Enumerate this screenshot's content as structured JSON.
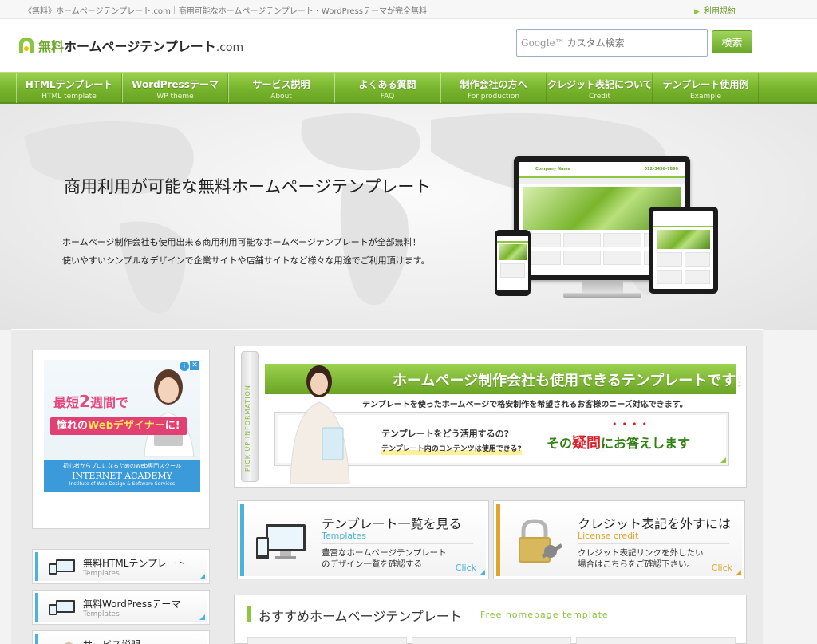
{
  "topbar": {
    "tagline": "《無料》ホームページテンプレート.com｜商用可能なホームページテンプレート・WordPressテーマが完全無料",
    "terms_link": "利用規約"
  },
  "header": {
    "logo_accent": "無料",
    "logo_main": "ホームページテンプレート",
    "logo_suffix": ".com",
    "search_brand": "Google™",
    "search_placeholder": "カスタム検索",
    "search_button": "検索"
  },
  "nav": [
    {
      "jp": "HTMLテンプレート",
      "en": "HTML template"
    },
    {
      "jp": "WordPressテーマ",
      "en": "WP theme"
    },
    {
      "jp": "サービス説明",
      "en": "About"
    },
    {
      "jp": "よくある質問",
      "en": "FAQ"
    },
    {
      "jp": "制作会社の方へ",
      "en": "For production"
    },
    {
      "jp": "クレジット表記について",
      "en": "Credit"
    },
    {
      "jp": "テンプレート使用例",
      "en": "Example"
    }
  ],
  "hero": {
    "title": "商用利用が可能な無料ホームページテンプレート",
    "line1": "ホームページ制作会社も使用出来る商用利用可能なホームページテンプレートが全部無料！",
    "line2": "使いやすいシンプルなデザインで企業サイトや店舗サイトなど様々な用途でご利用頂けます。",
    "mock_logo": "Company Name",
    "mock_tel": "012-3456-7890"
  },
  "ad": {
    "line1_pre": "最短",
    "line1_num": "2",
    "line1_post": "週間で",
    "line2_pre": "憧れの",
    "line2_hl": "Webデザイナー",
    "line2_post": "に!",
    "bottom1": "初心者からプロになるためのWeb専門スクール",
    "bottom2": "INTERNET ACADEMY",
    "bottom3": "Institute of Web Design & Software Services",
    "info_icon": "i",
    "close_icon": "✕"
  },
  "sidebar": [
    {
      "title": "無料HTMLテンプレート",
      "sub": "Templates"
    },
    {
      "title": "無料WordPressテーマ",
      "sub": "Templates"
    },
    {
      "title": "サービス説明",
      "sub": ""
    }
  ],
  "pickup": {
    "vertical_label": "PICK UP INFORMATION",
    "banner": "ホームページ制作会社も使用できるテンプレートです！",
    "sub": "テンプレートを使ったホームページで格安制作を希望されるお客様のニーズ対応できます。",
    "q1": "テンプレートをどう活用するの?",
    "q2": "テンプレート内のコンテンツは使用できる?",
    "ans_pre": "その",
    "ans_red": "疑問",
    "ans_post": "にお答えします"
  },
  "features": [
    {
      "title": "テンプレート一覧を見る",
      "en": "Templates",
      "desc1": "豊富なホームページテンプレート",
      "desc2": "のデザイン一覧を確認する",
      "click": "Click",
      "color": "#49b3d9"
    },
    {
      "title": "クレジット表記を外すには",
      "en": "License credit",
      "desc1": "クレジット表記リンクを外したい",
      "desc2": "場合はこちらをご確認下さい。",
      "click": "Click",
      "color": "#e0a52e"
    }
  ],
  "recommend": {
    "title": "おすすめホームページテンプレート",
    "en": "Free homepage template"
  },
  "colors": {
    "brand_green": "#8cc63f",
    "blue_accent": "#49b3d9",
    "orange_accent": "#e0a52e"
  }
}
